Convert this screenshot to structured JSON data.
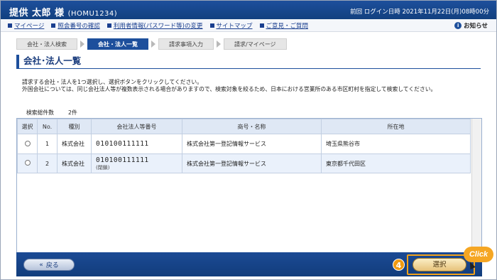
{
  "header": {
    "user_name": "提供 太郎 様",
    "user_id": "(HOMU1234)",
    "last_login": "前回 ログイン日時 2021年11月22日(月)08時00分"
  },
  "nav": {
    "links": [
      "マイページ",
      "照会番号の確認",
      "利用者情報(パスワード等)の変更",
      "サイトマップ",
      "ご意見・ご質問"
    ],
    "notice": "お知らせ"
  },
  "steps": [
    "会社・法人検索",
    "会社・法人一覧",
    "請求事項入力",
    "請求/マイページ"
  ],
  "page_title": "会社･法人一覧",
  "instructions": [
    "請求する会社・法人を1つ選択し、選択ボタンをクリックしてください。",
    "外国会社については、同じ会社法人等が複数表示される場合がありますので、検索対象を絞るため、日本における営業所のある市区町村を指定して検索してください。"
  ],
  "search_count": {
    "label": "検索総件数",
    "value": "2件"
  },
  "table": {
    "headers": [
      "選択",
      "No.",
      "種別",
      "会社法人等番号",
      "商号・名称",
      "所在地"
    ],
    "rows": [
      {
        "no": "1",
        "type": "株式会社",
        "corp_number": "010100111111",
        "note": "",
        "name": "株式会社第一登記情報サービス",
        "location": "埼玉県熊谷市"
      },
      {
        "no": "2",
        "type": "株式会社",
        "corp_number": "010100111111",
        "note": "(閉鎖)",
        "name": "株式会社第一登記情報サービス",
        "location": "東京都千代田区"
      }
    ]
  },
  "footer": {
    "back_label": "戻る",
    "select_label": "選択"
  },
  "annotation": {
    "step_number": "4",
    "click_label": "Click"
  },
  "colors": {
    "header_blue": "#1d4f9c",
    "accent_orange": "#f09a10"
  }
}
